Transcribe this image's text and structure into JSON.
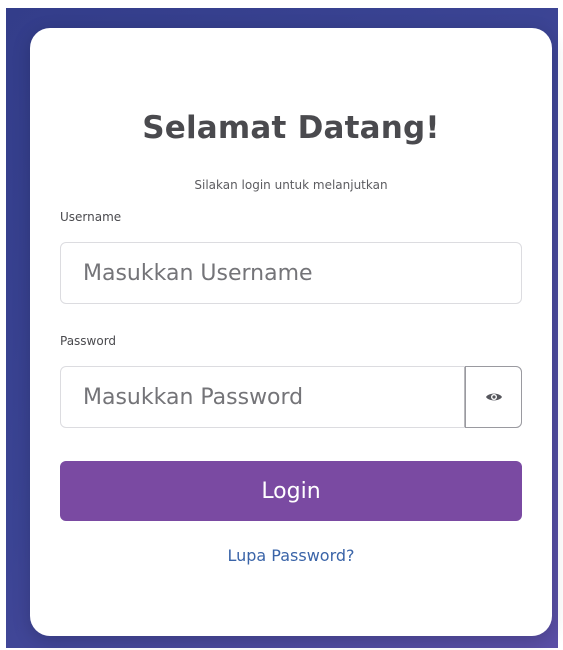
{
  "login": {
    "title": "Selamat Datang!",
    "subtitle": "Silakan login untuk melanjutkan",
    "username_label": "Username",
    "username_placeholder": "Masukkan Username",
    "password_label": "Password",
    "password_placeholder": "Masukkan Password",
    "toggle_icon": "eye-icon",
    "login_button": "Login",
    "forgot_link": "Lupa Password?"
  },
  "colors": {
    "background_gradient_start": "#333d8a",
    "background_gradient_end": "#5a4fa6",
    "button": "#7a4aa2",
    "link": "#3a64a8",
    "title": "#4a4a4e"
  }
}
